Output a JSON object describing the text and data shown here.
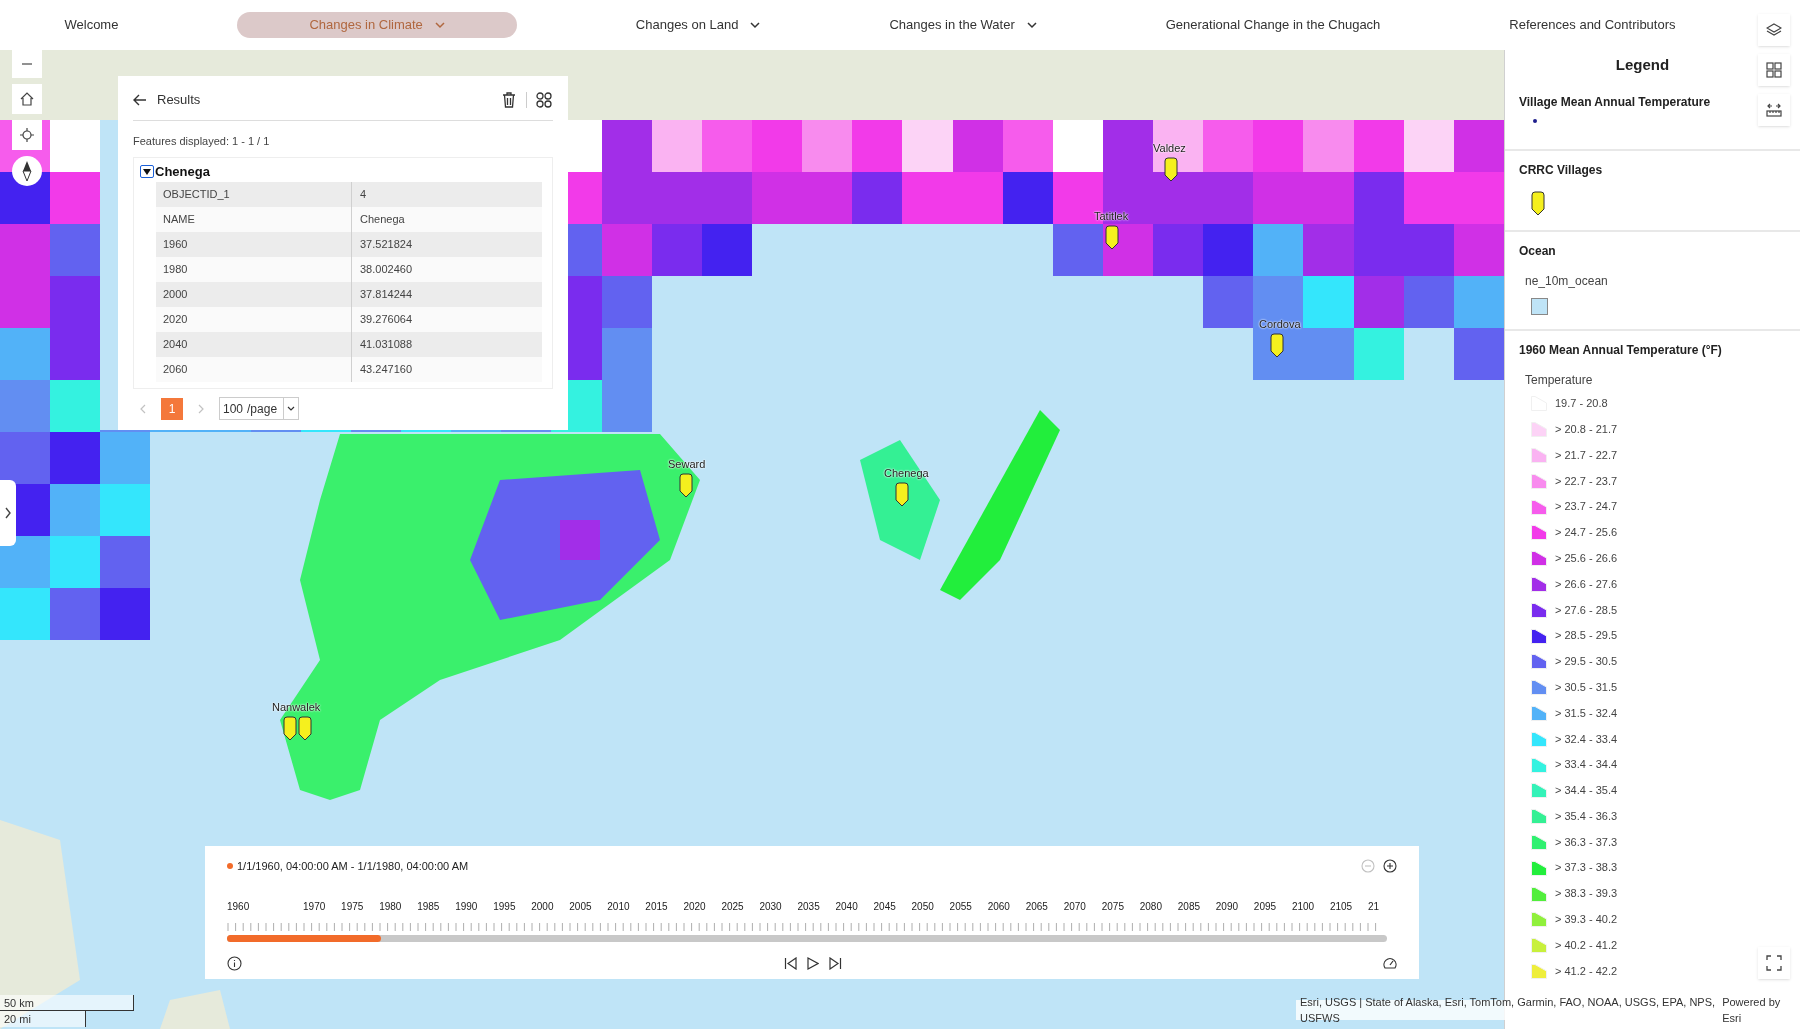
{
  "nav": [
    {
      "label": "Welcome",
      "selected": false,
      "has_menu": false
    },
    {
      "label": "Changes in Climate",
      "selected": true,
      "has_menu": true
    },
    {
      "label": "Changes on Land",
      "selected": false,
      "has_menu": true
    },
    {
      "label": "Changes in the Water",
      "selected": false,
      "has_menu": true
    },
    {
      "label": "Generational Change in the Chugach",
      "selected": false,
      "has_menu": false
    },
    {
      "label": "References and Contributors",
      "selected": false,
      "has_menu": false
    }
  ],
  "villages": [
    {
      "label": "Valdez"
    },
    {
      "label": "Tatitlek"
    },
    {
      "label": "Cordova"
    },
    {
      "label": "Seward"
    },
    {
      "label": "Chenega"
    },
    {
      "label": "Nanwalek"
    }
  ],
  "results": {
    "title": "Results",
    "features_displayed": "Features displayed: 1 - 1 / 1",
    "feature": {
      "name": "Chenega",
      "expanded": true,
      "attributes": [
        {
          "field": "OBJECTID_1",
          "value": "4"
        },
        {
          "field": "NAME",
          "value": "Chenega"
        },
        {
          "field": "1960",
          "value": "37.521824"
        },
        {
          "field": "1980",
          "value": "38.002460"
        },
        {
          "field": "2000",
          "value": "37.814244"
        },
        {
          "field": "2020",
          "value": "39.276064"
        },
        {
          "field": "2040",
          "value": "41.031088"
        },
        {
          "field": "2060",
          "value": "43.247160"
        }
      ]
    },
    "previous": {
      "disabled": true
    },
    "next": {
      "disabled": true
    },
    "pages": [
      {
        "label": "1",
        "selected": true
      }
    ],
    "page_size": "100",
    "page_size_unit": "/page"
  },
  "timeline": {
    "range": "1/1/1960, 04:00:00 AM - 1/1/1980, 04:00:00 AM",
    "zoom_out_disabled": true,
    "level": 0.133,
    "labels": [
      "1960",
      "1970",
      "1975",
      "1980",
      "1985",
      "1990",
      "1995",
      "2000",
      "2005",
      "2010",
      "2015",
      "2020",
      "2025",
      "2030",
      "2035",
      "2040",
      "2045",
      "2050",
      "2055",
      "2060",
      "2065",
      "2070",
      "2075",
      "2080",
      "2085",
      "2090",
      "2095",
      "2100",
      "2105",
      "21"
    ]
  },
  "legend": {
    "title": "Legend",
    "layers": [
      {
        "kind": "dot",
        "title": "Village Mean Annual Temperature",
        "color": "#1e1e8c"
      },
      {
        "kind": "pin",
        "title": "CRRC Villages",
        "color": "#f5f01e"
      },
      {
        "kind": "swatches",
        "title": "Ocean",
        "items": [
          {
            "label": "ne_10m_ocean",
            "color": "#bfe4f7"
          }
        ]
      },
      {
        "kind": "classes",
        "title": "1960 Mean Annual Temperature (°F)",
        "field": "Temperature",
        "items": [
          {
            "label": "19.7 - 20.8",
            "color": "#ffffff"
          },
          {
            "label": "> 20.8 - 21.7",
            "color": "#fcd3f6"
          },
          {
            "label": "> 21.7 - 22.7",
            "color": "#fab3f2"
          },
          {
            "label": "> 22.7 - 23.7",
            "color": "#f88bee"
          },
          {
            "label": "> 23.7 - 24.7",
            "color": "#f65cec"
          },
          {
            "label": "> 24.7 - 25.6",
            "color": "#f23ae9"
          },
          {
            "label": "> 25.6 - 26.6",
            "color": "#d030e6"
          },
          {
            "label": "> 26.6 - 27.6",
            "color": "#a22ee8"
          },
          {
            "label": "> 27.6 - 28.5",
            "color": "#7a2cee"
          },
          {
            "label": "> 28.5 - 29.5",
            "color": "#4422f0"
          },
          {
            "label": "> 29.5 - 30.5",
            "color": "#6262f0"
          },
          {
            "label": "> 30.5 - 31.5",
            "color": "#628ef2"
          },
          {
            "label": "> 31.5 - 32.4",
            "color": "#52b2f8"
          },
          {
            "label": "> 32.4 - 33.4",
            "color": "#34e6fc"
          },
          {
            "label": "> 33.4 - 34.4",
            "color": "#34f2e0"
          },
          {
            "label": "> 34.4 - 35.4",
            "color": "#34f2b8"
          },
          {
            "label": "> 35.4 - 36.3",
            "color": "#34f094"
          },
          {
            "label": "> 36.3 - 37.3",
            "color": "#30f070"
          },
          {
            "label": "> 37.3 - 38.3",
            "color": "#22ee3c"
          },
          {
            "label": "> 38.3 - 39.3",
            "color": "#52ee3c"
          },
          {
            "label": "> 39.3 - 40.2",
            "color": "#90f03c"
          },
          {
            "label": "> 40.2 - 41.2",
            "color": "#c8f03c"
          },
          {
            "label": "> 41.2 - 42.2",
            "color": "#eeee3c"
          }
        ]
      }
    ]
  },
  "scale_bar": {
    "metric": "50 km",
    "imperial": "20 mi"
  },
  "attribution": {
    "sources": "Esri, USGS | State of Alaska, Esri, TomTom, Garmin, FAO, NOAA, USGS, EPA, NPS, USFWS",
    "powered_by": "Powered by Esri"
  }
}
